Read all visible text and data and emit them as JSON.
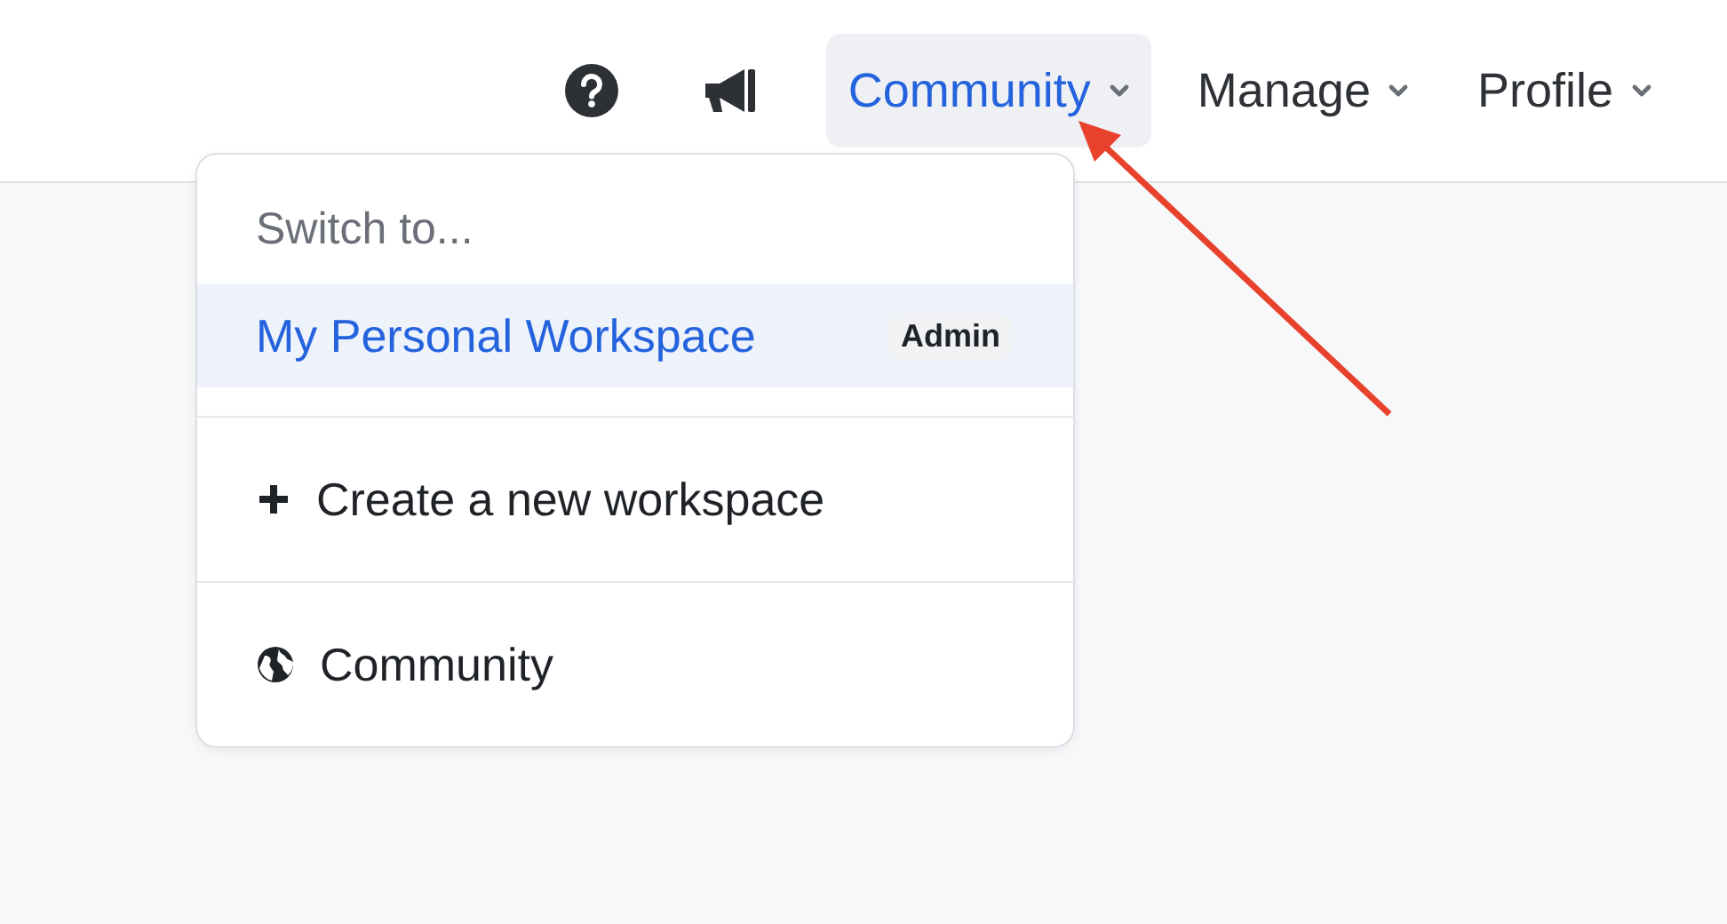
{
  "nav": [
    {
      "label": "Community",
      "selected": true
    },
    {
      "label": "Manage",
      "selected": false
    },
    {
      "label": "Profile",
      "selected": false
    }
  ],
  "menu": {
    "heading": "Switch to...",
    "workspaces": [
      {
        "label": "My Personal Workspace",
        "badge": "Admin",
        "selected": true
      }
    ],
    "actions": [
      {
        "kind": "create",
        "label": "Create a new workspace"
      },
      {
        "kind": "community",
        "label": "Community"
      }
    ]
  },
  "annotation": {
    "kind": "arrow"
  }
}
